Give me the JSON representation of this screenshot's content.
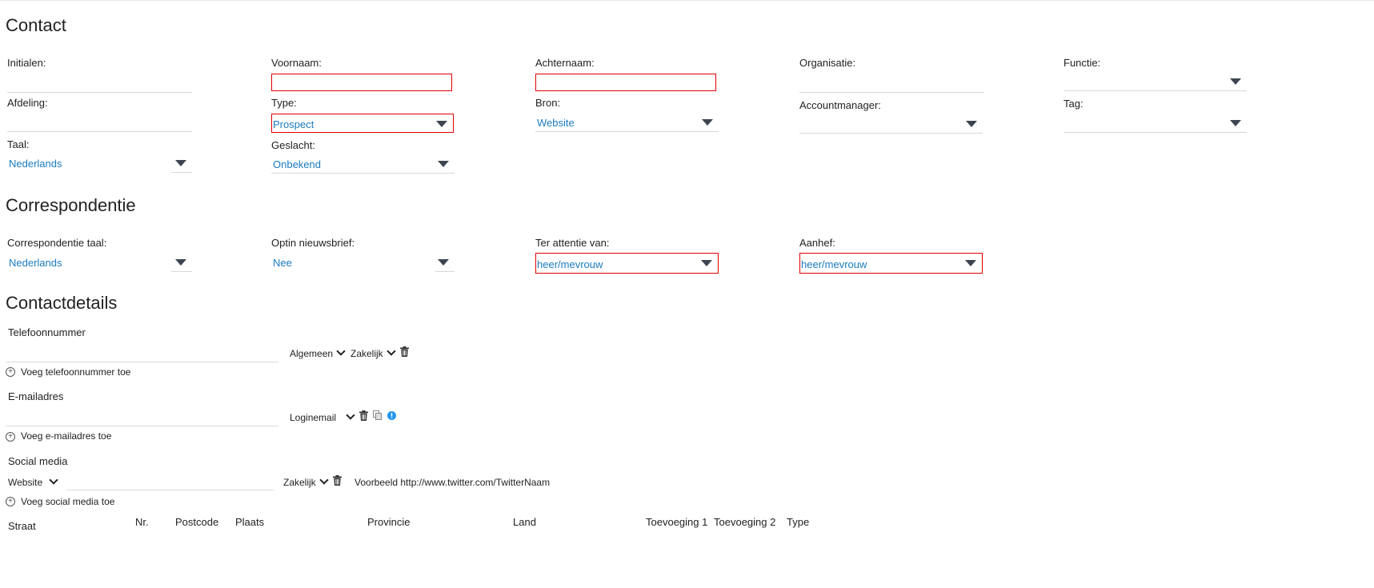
{
  "sections": {
    "contact": "Contact",
    "correspondentie": "Correspondentie",
    "contactdetails": "Contactdetails"
  },
  "contact": {
    "initialen_label": "Initialen:",
    "voornaam_label": "Voornaam:",
    "achternaam_label": "Achternaam:",
    "organisatie_label": "Organisatie:",
    "functie_label": "Functie:",
    "afdeling_label": "Afdeling:",
    "type_label": "Type:",
    "type_value": "Prospect",
    "bron_label": "Bron:",
    "bron_value": "Website",
    "accountmanager_label": "Accountmanager:",
    "tag_label": "Tag:",
    "taal_label": "Taal:",
    "taal_value": "Nederlands",
    "geslacht_label": "Geslacht:",
    "geslacht_value": "Onbekend"
  },
  "correspondentie": {
    "taal_label": "Correspondentie taal:",
    "taal_value": "Nederlands",
    "optin_label": "Optin nieuwsbrief:",
    "optin_value": "Nee",
    "attentie_label": "Ter attentie van:",
    "attentie_value": "heer/mevrouw",
    "aanhef_label": "Aanhef:",
    "aanhef_value": "heer/mevrouw"
  },
  "details": {
    "telefoon_label": "Telefoonnummer",
    "telefoon_type1": "Algemeen",
    "telefoon_type2": "Zakelijk",
    "telefoon_add": "Voeg telefoonnummer toe",
    "email_label": "E-mailadres",
    "email_type": "Loginemail",
    "email_add": "Voeg e-mailadres toe",
    "social_label": "Social media",
    "social_type": "Website",
    "social_kind": "Zakelijk",
    "social_example": "Voorbeeld http://www.twitter.com/TwitterNaam",
    "social_add": "Voeg social media toe"
  },
  "address_headers": {
    "straat": "Straat",
    "nr": "Nr.",
    "postcode": "Postcode",
    "plaats": "Plaats",
    "provincie": "Provincie",
    "land": "Land",
    "toevoeging1": "Toevoeging 1",
    "toevoeging2": "Toevoeging 2",
    "type": "Type"
  },
  "colors": {
    "required_border": "#e00000",
    "value_text": "#1a7bc0",
    "info_icon": "#2196f3"
  }
}
